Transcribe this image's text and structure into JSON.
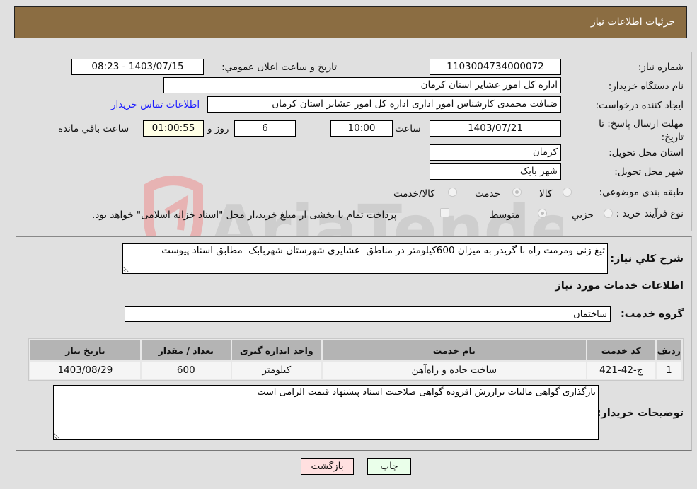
{
  "header": {
    "title": "جزئیات اطلاعات نیاز"
  },
  "form": {
    "need_number": {
      "label": "شماره نیاز:",
      "value": "1103004734000072"
    },
    "announce_datetime": {
      "label": "تاریخ و ساعت اعلان عمومي:",
      "value": "1403/07/15 - 08:23"
    },
    "buyer_org": {
      "label": "نام دستگاه خریدار:",
      "value": "اداره کل امور عشایر استان کرمان"
    },
    "requester": {
      "label": "ایجاد کننده درخواست:",
      "value": "ضیافت محمدی کارشناس امور اداری اداره کل امور عشایر استان کرمان"
    },
    "buyer_contact_link": "اطلاعات تماس خریدار",
    "deadline": {
      "label": "مهلت ارسال پاسخ: تا تاریخ:",
      "date": "1403/07/21",
      "time_label": "ساعت",
      "time": "10:00",
      "days": "6",
      "days_label": "روز و",
      "remaining": "01:00:55",
      "remaining_label": "ساعت باقي مانده"
    },
    "delivery_province": {
      "label": "استان محل تحویل:",
      "value": "کرمان"
    },
    "delivery_city": {
      "label": "شهر محل تحویل:",
      "value": "شهر بابک"
    },
    "category": {
      "label": "طبقه بندی موضوعی:",
      "options": [
        "کالا",
        "خدمت",
        "کالا/خدمت"
      ],
      "selected": "خدمت"
    },
    "purchase_type": {
      "label": "نوع فرآیند خرید :",
      "options": [
        "جزيي",
        "متوسط"
      ],
      "selected": "متوسط",
      "treasury_note": "پرداخت تمام یا بخشی از مبلغ خرید،از محل \"اسناد خزانه اسلامی\" خواهد بود."
    }
  },
  "details": {
    "description_label": "شرح كلي نياز:",
    "description": "تیغ زنی ومرمت راه با گریدر به میزان 600کیلومتر در مناطق  عشایری شهرستان شهربابک  مطابق اسناد پیوست",
    "services_heading": "اطلاعات خدمات مورد نیاز",
    "service_group_label": "گروه خدمت:",
    "service_group": "ساختمان",
    "table": {
      "headers": [
        "ردیف",
        "کد خدمت",
        "نام خدمت",
        "واحد اندازه گیری",
        "تعداد / مقدار",
        "تاریخ نیاز"
      ],
      "rows": [
        [
          "1",
          "ج-42-421",
          "ساخت جاده و راه‌آهن",
          "کیلومتر",
          "600",
          "1403/08/29"
        ]
      ]
    },
    "buyer_notes_label": "توضیحات خریدار:",
    "buyer_notes": "بارگذاری گواهی مالیات برارزش افزوده گواهی صلاحیت اسناد پیشنهاد قیمت الزامی است"
  },
  "buttons": {
    "print": "چاپ",
    "back": "بازگشت"
  },
  "watermark": "AriaTender.neT",
  "colors": {
    "header_bg": "#8b6d42",
    "print_btn": "#eaffea",
    "back_btn": "#ffe0e0",
    "link": "#1a1aff"
  }
}
